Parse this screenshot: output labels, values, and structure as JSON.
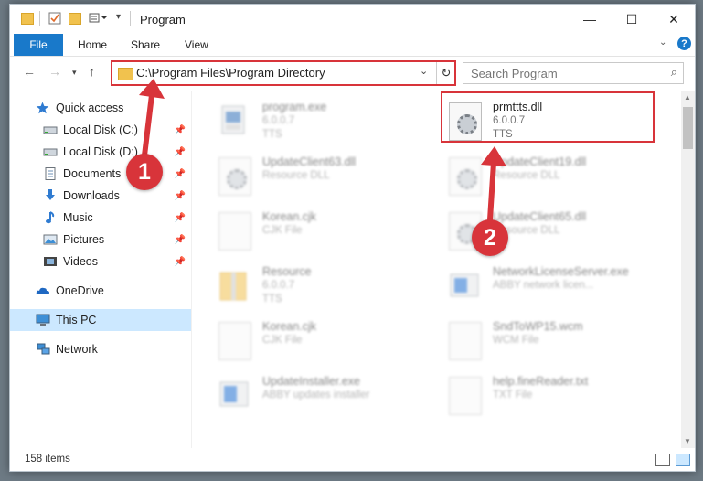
{
  "window": {
    "title": "Program",
    "controls": {
      "minimize": "—",
      "maximize": "☐",
      "close": "✕"
    }
  },
  "ribbon": {
    "tabs": [
      "File",
      "Home",
      "Share",
      "View"
    ],
    "help": "?"
  },
  "nav": {
    "address": "C:\\Program Files\\Program Directory",
    "search_placeholder": "Search Program"
  },
  "sidebar": {
    "items": [
      {
        "label": "Quick access",
        "icon": "star-icon",
        "pinned": false
      },
      {
        "label": "Local Disk (C:)",
        "icon": "drive-icon",
        "pinned": true
      },
      {
        "label": "Local Disk (D:)",
        "icon": "drive-icon",
        "pinned": true
      },
      {
        "label": "Documents",
        "icon": "documents-icon",
        "pinned": true
      },
      {
        "label": "Downloads",
        "icon": "download-icon",
        "pinned": true
      },
      {
        "label": "Music",
        "icon": "music-icon",
        "pinned": true
      },
      {
        "label": "Pictures",
        "icon": "pictures-icon",
        "pinned": true
      },
      {
        "label": "Videos",
        "icon": "videos-icon",
        "pinned": true
      },
      {
        "label": "OneDrive",
        "icon": "cloud-icon",
        "pinned": false
      },
      {
        "label": "This PC",
        "icon": "computer-icon",
        "pinned": false,
        "selected": true
      },
      {
        "label": "Network",
        "icon": "network-icon",
        "pinned": false
      }
    ]
  },
  "files": {
    "left": [
      {
        "name": "program.exe",
        "line2": "6.0.0.7",
        "line3": "TTS",
        "icon": "exe-icon"
      },
      {
        "name": "UpdateClient63.dll",
        "line2": "Resource DLL",
        "icon": "dll-icon"
      },
      {
        "name": "Korean.cjk",
        "line2": "CJK File",
        "icon": "file-icon"
      },
      {
        "name": "Resource",
        "line2": "6.0.0.7",
        "line3": "TTS",
        "icon": "folder-zip-icon"
      },
      {
        "name": "Korean.cjk",
        "line2": "CJK File",
        "icon": "file-icon"
      },
      {
        "name": "UpdateInstaller.exe",
        "line2": "ABBY updates installer",
        "icon": "installer-icon"
      }
    ],
    "right": [
      {
        "name": "prmttts.dll",
        "line2": "6.0.0.7",
        "line3": "TTS",
        "icon": "dll-icon",
        "highlighted": true
      },
      {
        "name": "UpdateClient19.dll",
        "line2": "Resource DLL",
        "icon": "dll-icon"
      },
      {
        "name": "UpdateClient65.dll",
        "line2": "Resource DLL",
        "icon": "dll-icon"
      },
      {
        "name": "NetworkLicenseServer.exe",
        "line2": "ABBY network licen...",
        "icon": "app-icon"
      },
      {
        "name": "SndToWP15.wcm",
        "line2": "WCM File",
        "icon": "file-icon"
      },
      {
        "name": "help.fineReader.txt",
        "line2": "TXT File",
        "icon": "file-icon"
      }
    ]
  },
  "status": {
    "count": "158 items"
  },
  "callouts": [
    "1",
    "2"
  ],
  "colors": {
    "accent": "#1979ca",
    "highlight": "#d8343a",
    "selected": "#cce8ff"
  }
}
